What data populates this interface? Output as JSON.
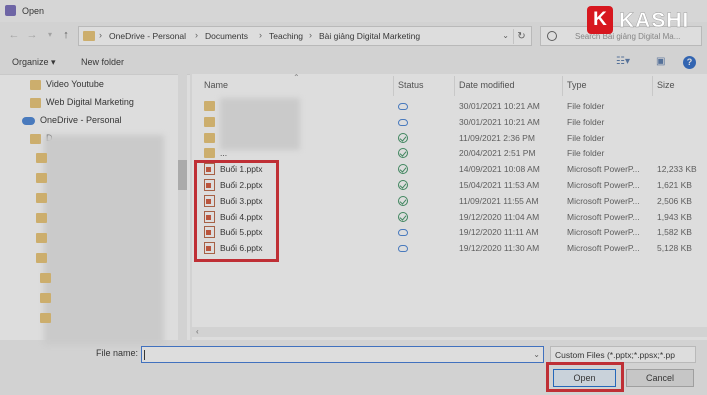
{
  "window": {
    "title": "Open"
  },
  "address": {
    "crumbs": [
      "OneDrive - Personal",
      "Documents",
      "Teaching",
      "Bài giảng Digital Marketing"
    ],
    "search_placeholder": "Search Bài giảng Digital Ma..."
  },
  "toolbar": {
    "organize": "Organize ▾",
    "new_folder": "New folder"
  },
  "navpane": {
    "items": [
      {
        "label": "Video Youtube"
      },
      {
        "label": "Web Digital Marketing"
      },
      {
        "label": "OneDrive - Personal"
      },
      {
        "label": "D"
      }
    ]
  },
  "columns": {
    "name": "Name",
    "status": "Status",
    "date": "Date modified",
    "type": "Type",
    "size": "Size"
  },
  "files": [
    {
      "name": "",
      "status": "cloud",
      "date": "30/01/2021 10:21 AM",
      "type": "File folder",
      "size": ""
    },
    {
      "name": "",
      "status": "cloud",
      "date": "30/01/2021 10:21 AM",
      "type": "File folder",
      "size": ""
    },
    {
      "name": "",
      "status": "check",
      "date": "11/09/2021 2:36 PM",
      "type": "File folder",
      "size": ""
    },
    {
      "name": "...",
      "status": "check",
      "date": "20/04/2021 2:51 PM",
      "type": "File folder",
      "size": ""
    },
    {
      "name": "Buổi 1.pptx",
      "status": "check",
      "date": "14/09/2021 10:08 AM",
      "type": "Microsoft PowerP...",
      "size": "12,233 KB"
    },
    {
      "name": "Buổi 2.pptx",
      "status": "check",
      "date": "15/04/2021 11:53 AM",
      "type": "Microsoft PowerP...",
      "size": "1,621 KB"
    },
    {
      "name": "Buổi 3.pptx",
      "status": "check",
      "date": "11/09/2021 11:55 AM",
      "type": "Microsoft PowerP...",
      "size": "2,506 KB"
    },
    {
      "name": "Buổi 4.pptx",
      "status": "check",
      "date": "19/12/2020 11:04 AM",
      "type": "Microsoft PowerP...",
      "size": "1,943 KB"
    },
    {
      "name": "Buổi 5.pptx",
      "status": "cloud",
      "date": "19/12/2020 11:11 AM",
      "type": "Microsoft PowerP...",
      "size": "1,582 KB"
    },
    {
      "name": "Buổi 6.pptx",
      "status": "cloud",
      "date": "19/12/2020 11:30 AM",
      "type": "Microsoft PowerP...",
      "size": "5,128 KB"
    }
  ],
  "bottom": {
    "file_name_label": "File name:",
    "file_name_value": "",
    "filter": "Custom Files (*.pptx;*.ppsx;*.pp",
    "open": "Open",
    "cancel": "Cancel"
  },
  "watermark": {
    "logo_letter": "K",
    "text": "KASHI"
  }
}
